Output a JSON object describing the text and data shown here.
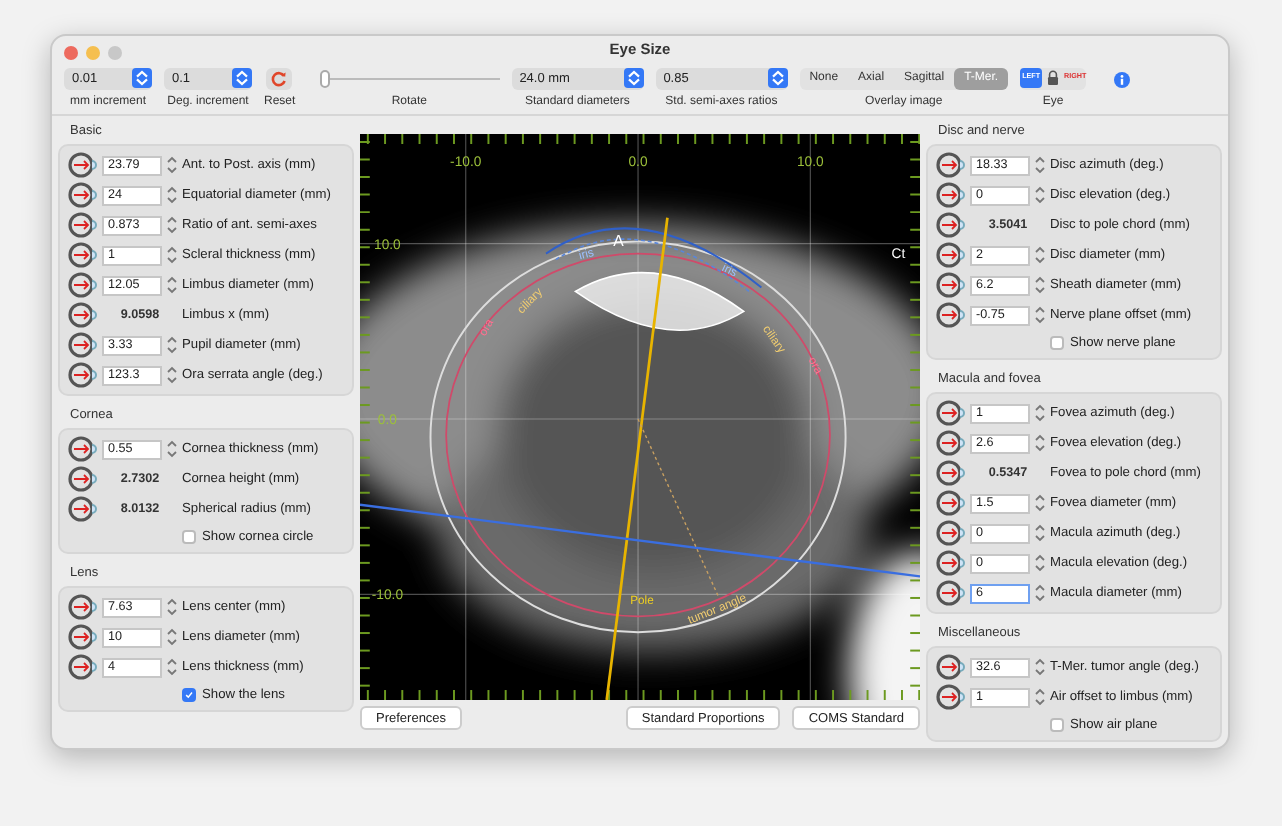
{
  "window": {
    "title": "Eye Size"
  },
  "toolbar": {
    "mm_increment": {
      "value": "0.01",
      "label": "mm increment"
    },
    "deg_increment": {
      "value": "0.1",
      "label": "Deg. increment"
    },
    "reset": {
      "label": "Reset"
    },
    "rotate": {
      "label": "Rotate",
      "level": 0
    },
    "standard_diameters": {
      "value": "24.0 mm",
      "label": "Standard diameters"
    },
    "semi_axes_ratios": {
      "value": "0.85",
      "label": "Std. semi-axes ratios"
    },
    "overlay": {
      "label": "Overlay image",
      "options": [
        {
          "label": "None",
          "selected": false
        },
        {
          "label": "Axial",
          "selected": false
        },
        {
          "label": "Sagittal",
          "selected": false
        },
        {
          "label": "T-Mer.",
          "selected": true
        }
      ]
    },
    "eye": {
      "label": "Eye",
      "options": [
        {
          "kind": "text",
          "label": "LEFT",
          "selected": true
        },
        {
          "kind": "lock",
          "selected": false
        },
        {
          "kind": "text",
          "label": "RIGHT",
          "selected": false
        }
      ]
    }
  },
  "left_panel": [
    {
      "title": "Basic",
      "rows": [
        {
          "kind": "field",
          "value": "23.79",
          "label": "Ant. to Post. axis (mm)",
          "focused": false
        },
        {
          "kind": "field",
          "value": "24",
          "label": "Equatorial diameter (mm)",
          "focused": false
        },
        {
          "kind": "field",
          "value": "0.873",
          "label": "Ratio of ant. semi-axes",
          "focused": false
        },
        {
          "kind": "field",
          "value": "1",
          "label": "Scleral thickness (mm)",
          "focused": false
        },
        {
          "kind": "field",
          "value": "12.05",
          "label": "Limbus diameter (mm)",
          "focused": false
        },
        {
          "kind": "readout",
          "value": "9.0598",
          "label": "Limbus x (mm)"
        },
        {
          "kind": "field",
          "value": "3.33",
          "label": "Pupil diameter (mm)",
          "focused": false
        },
        {
          "kind": "field",
          "value": "123.3",
          "label": "Ora serrata angle (deg.)",
          "focused": false
        }
      ]
    },
    {
      "title": "Cornea",
      "rows": [
        {
          "kind": "field",
          "value": "0.55",
          "label": "Cornea thickness (mm)",
          "focused": false
        },
        {
          "kind": "readout",
          "value": "2.7302",
          "label": "Cornea height (mm)"
        },
        {
          "kind": "readout",
          "value": "8.0132",
          "label": "Spherical radius (mm)"
        },
        {
          "kind": "checkbox",
          "label": "Show cornea circle",
          "checked": false
        }
      ]
    },
    {
      "title": "Lens",
      "rows": [
        {
          "kind": "field",
          "value": "7.63",
          "label": "Lens center (mm)",
          "focused": false
        },
        {
          "kind": "field",
          "value": "10",
          "label": "Lens diameter (mm)",
          "focused": false
        },
        {
          "kind": "field",
          "value": "4",
          "label": "Lens thickness (mm)",
          "focused": false
        },
        {
          "kind": "checkbox",
          "label": "Show the lens",
          "checked": true
        }
      ]
    }
  ],
  "viewer": {
    "x_ticks": [
      "-10.0",
      "0.0",
      "10.0"
    ],
    "y_ticks": [
      "10.0",
      "0.0",
      "-10.0"
    ],
    "anterior_label": "A",
    "ct_label": "Ct",
    "iris_labels": [
      "iris",
      "iris"
    ],
    "ciliary_labels": [
      "ciliary",
      "ciliary"
    ],
    "ora_labels": [
      "ora",
      "ora"
    ],
    "pole_label": "Pole",
    "tumor_angle_label": "tumor angle"
  },
  "buttons": [
    "Preferences",
    "Standard Proportions",
    "COMS Standard"
  ],
  "right_panel": [
    {
      "title": "Disc and nerve",
      "rows": [
        {
          "kind": "field",
          "value": "18.33",
          "label": "Disc azimuth (deg.)",
          "focused": false
        },
        {
          "kind": "field",
          "value": "0",
          "label": "Disc elevation (deg.)",
          "focused": false
        },
        {
          "kind": "readout",
          "value": "3.5041",
          "label": "Disc to pole chord (mm)"
        },
        {
          "kind": "field",
          "value": "2",
          "label": "Disc diameter (mm)",
          "focused": false
        },
        {
          "kind": "field",
          "value": "6.2",
          "label": "Sheath diameter (mm)",
          "focused": false
        },
        {
          "kind": "field",
          "value": "-0.75",
          "label": "Nerve plane offset (mm)",
          "focused": false
        },
        {
          "kind": "checkbox",
          "label": "Show nerve plane",
          "checked": false
        }
      ]
    },
    {
      "title": "Macula and fovea",
      "rows": [
        {
          "kind": "field",
          "value": "1",
          "label": "Fovea azimuth (deg.)",
          "focused": false
        },
        {
          "kind": "field",
          "value": "2.6",
          "label": "Fovea elevation (deg.)",
          "focused": false
        },
        {
          "kind": "readout",
          "value": "0.5347",
          "label": "Fovea to pole chord (mm)"
        },
        {
          "kind": "field",
          "value": "1.5",
          "label": "Fovea diameter (mm)",
          "focused": false
        },
        {
          "kind": "field",
          "value": "0",
          "label": "Macula azimuth (deg.)",
          "focused": false
        },
        {
          "kind": "field",
          "value": "0",
          "label": "Macula elevation (deg.)",
          "focused": false
        },
        {
          "kind": "field",
          "value": "6",
          "label": "Macula diameter (mm)",
          "focused": true
        }
      ]
    },
    {
      "title": "Miscellaneous",
      "rows": [
        {
          "kind": "field",
          "value": "32.6",
          "label": "T-Mer. tumor angle (deg.)",
          "focused": false
        },
        {
          "kind": "field",
          "value": "1",
          "label": "Air offset to limbus (mm)",
          "focused": false
        },
        {
          "kind": "checkbox",
          "label": "Show air plane",
          "checked": false
        }
      ]
    }
  ]
}
